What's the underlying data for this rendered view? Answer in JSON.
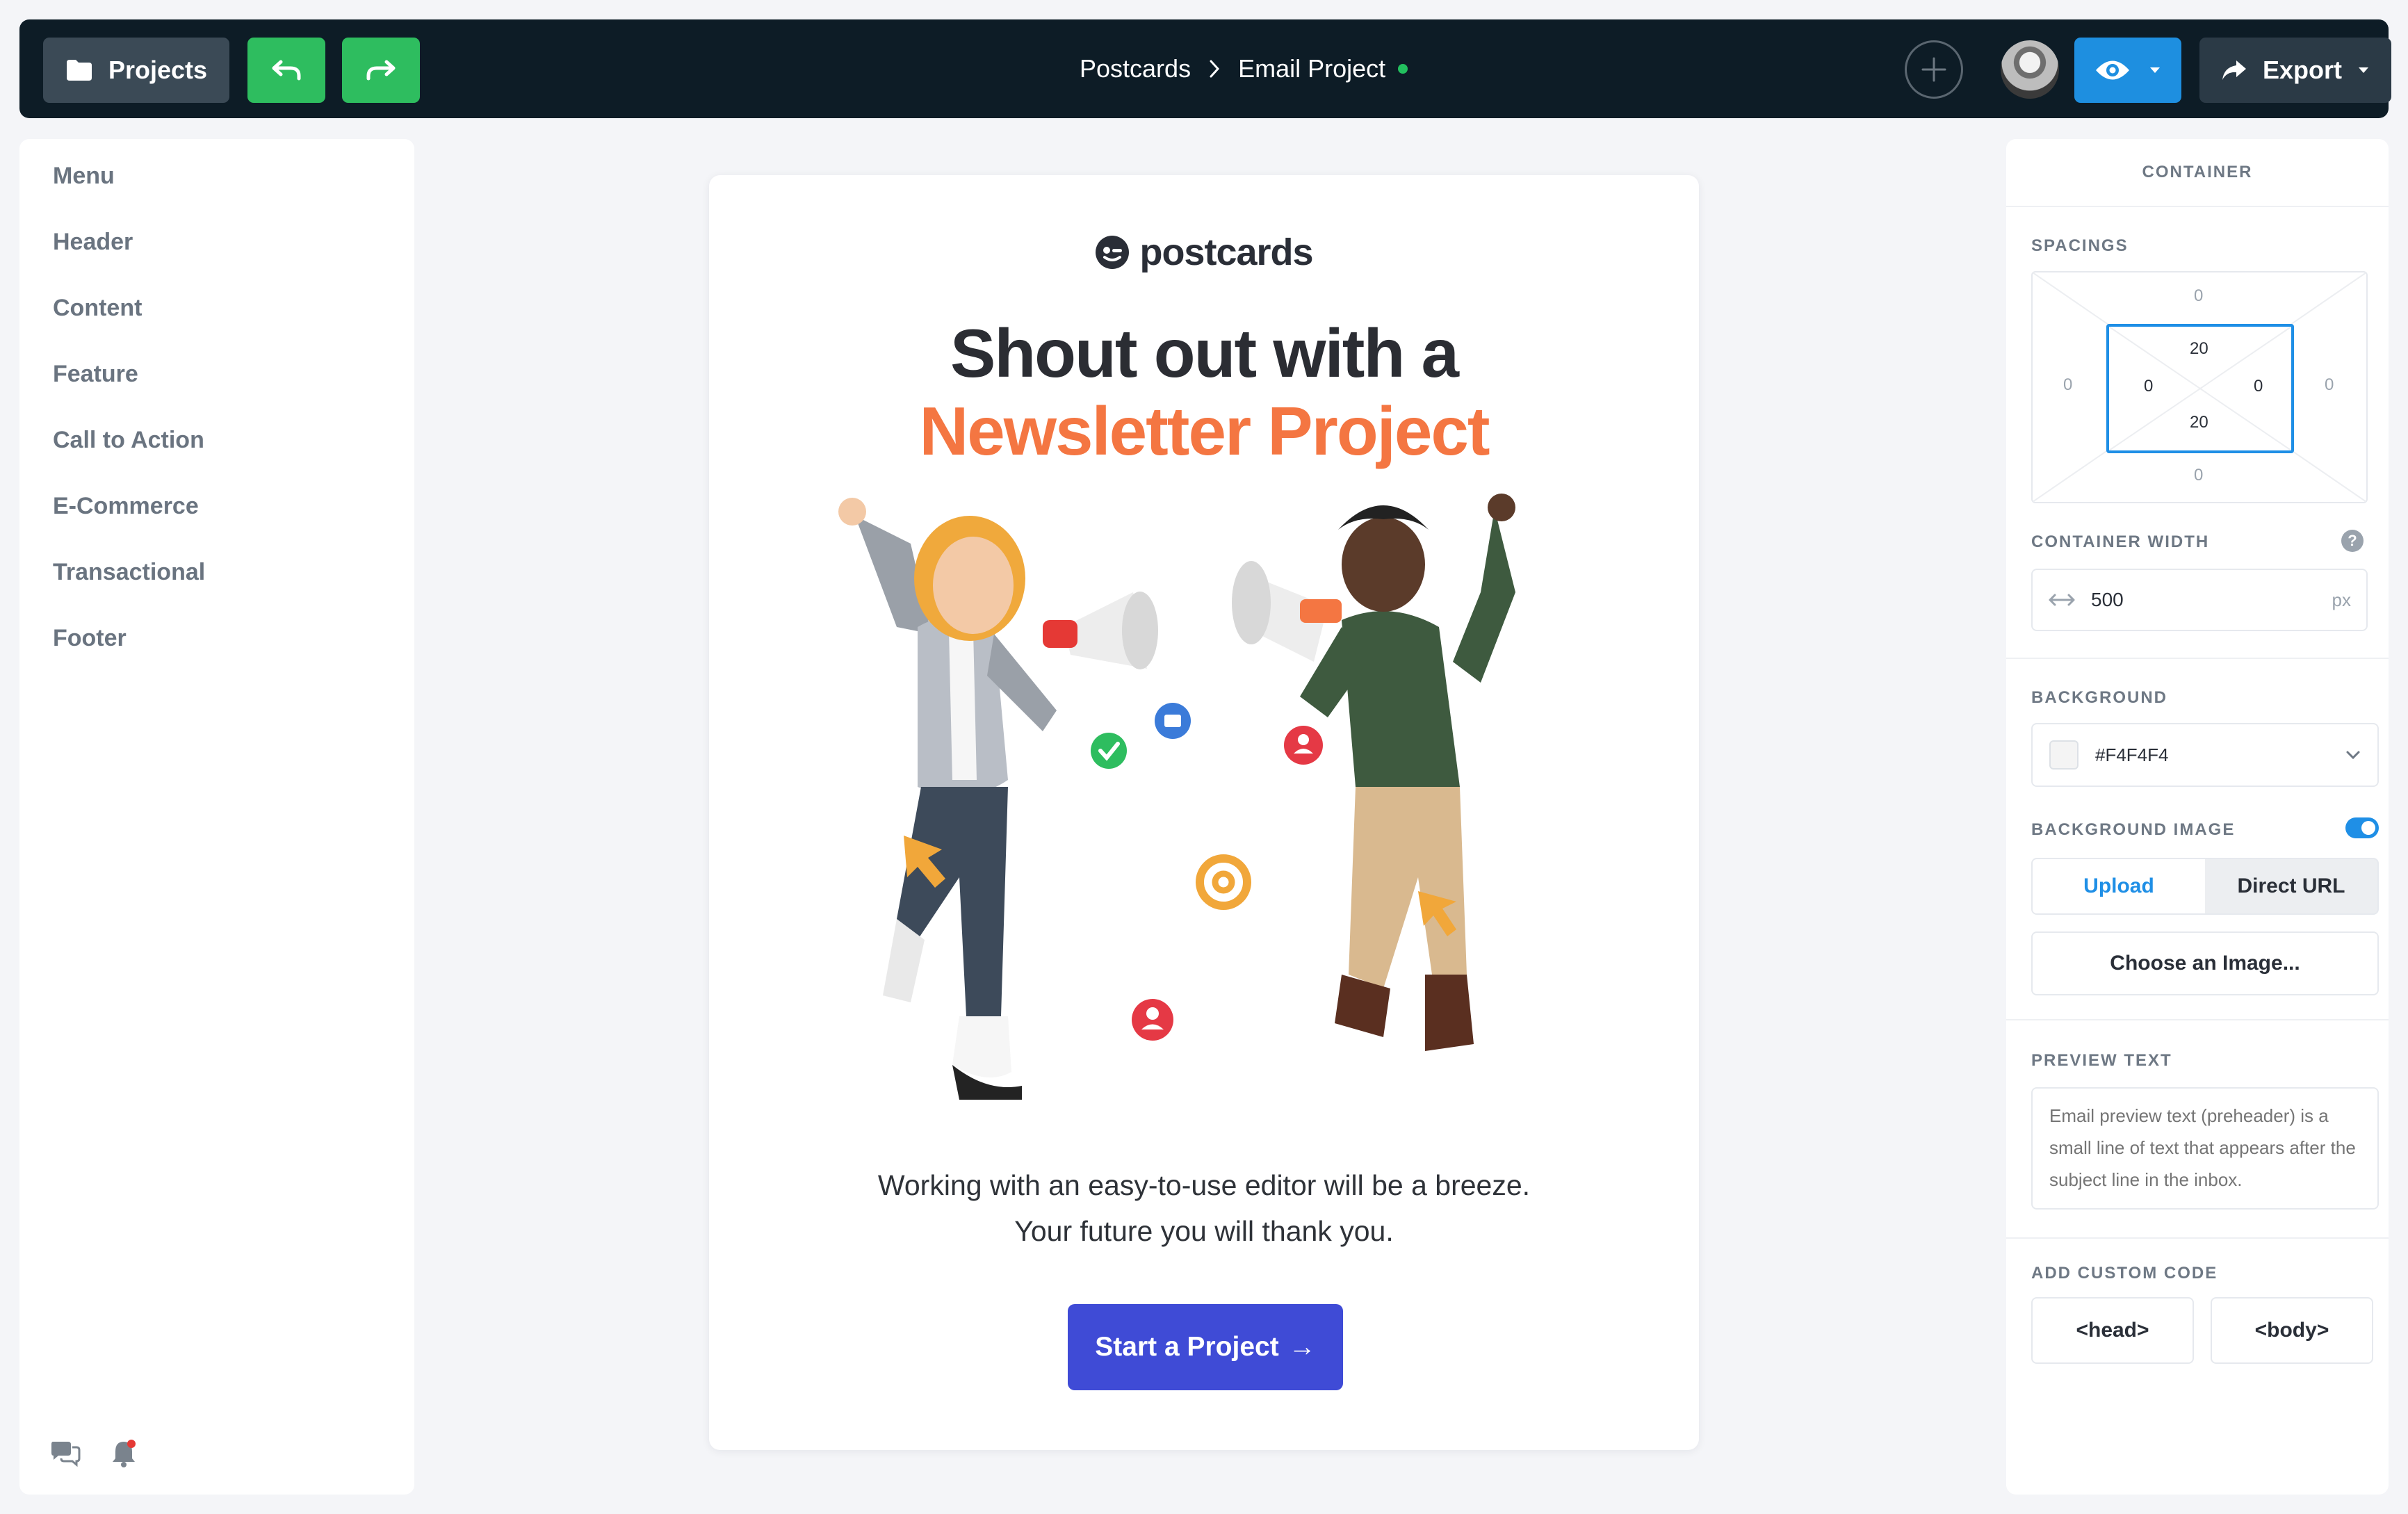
{
  "toolbar": {
    "projects_label": "Projects",
    "export_label": "Export",
    "breadcrumb": {
      "parent": "Postcards",
      "current": "Email Project"
    }
  },
  "sidebar": {
    "items": [
      {
        "label": "Menu"
      },
      {
        "label": "Header"
      },
      {
        "label": "Content"
      },
      {
        "label": "Feature"
      },
      {
        "label": "Call to Action"
      },
      {
        "label": "E-Commerce"
      },
      {
        "label": "Transactional"
      },
      {
        "label": "Footer"
      }
    ],
    "icons": [
      "chat-icon",
      "bell-icon"
    ]
  },
  "email": {
    "logo_text": "postcards",
    "headline_line1": "Shout out with a",
    "headline_line2": "Newsletter Project",
    "body": "Working with an easy-to-use editor will be a breeze. Your future you will thank you.",
    "cta_label": "Start a Project",
    "cta_arrow": "→",
    "accent_color": "#f47642",
    "button_color": "#3f4bd6"
  },
  "panel": {
    "title": "CONTAINER",
    "spacings": {
      "label": "SPACINGS",
      "margin": {
        "top": "0",
        "right": "0",
        "bottom": "0",
        "left": "0"
      },
      "padding": {
        "top": "20",
        "right": "0",
        "bottom": "20",
        "left": "0"
      }
    },
    "container_width": {
      "label": "CONTAINER WIDTH",
      "help": "?",
      "value": "500",
      "unit": "px"
    },
    "background": {
      "label": "BACKGROUND",
      "value": "#F4F4F4"
    },
    "background_image": {
      "label": "BACKGROUND IMAGE",
      "enabled": true,
      "tabs": [
        "Upload",
        "Direct URL"
      ],
      "active_tab": "Upload",
      "choose_label": "Choose an Image..."
    },
    "preview_text": {
      "label": "PREVIEW TEXT",
      "placeholder": "Email preview text (preheader) is a small line of text that appears after the subject line in the inbox."
    },
    "custom_code": {
      "label": "ADD CUSTOM CODE",
      "head": "<head>",
      "body": "<body>"
    }
  },
  "colors": {
    "topbar": "#0d1c26",
    "green_button": "#2ebd5f",
    "preview_button": "#1e8fe0",
    "active_blue": "#1f8fe6",
    "status_dot": "#22c05e"
  }
}
